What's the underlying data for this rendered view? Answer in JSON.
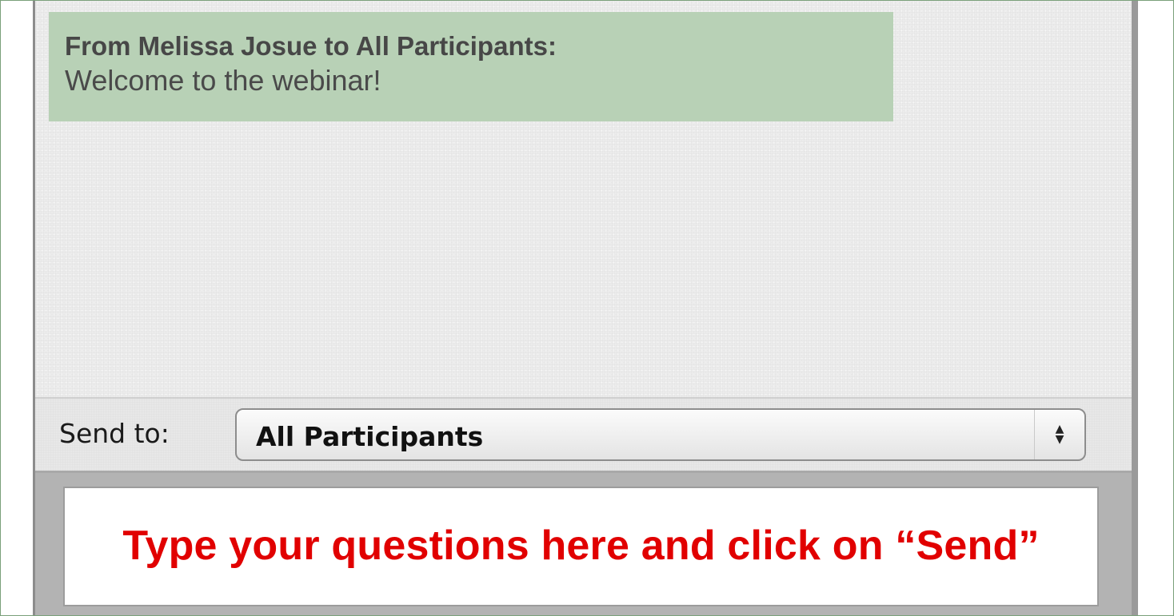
{
  "chat": {
    "message": {
      "header": "From Melissa Josue to All Participants:",
      "body": "Welcome to the webinar!"
    },
    "send_to": {
      "label": "Send to:",
      "selected": "All Participants"
    },
    "input": {
      "hint": "Type your questions here and click on “Send”"
    }
  },
  "icons": {
    "select_arrows": "up-down-chevron-icon"
  },
  "colors": {
    "callout_background": "#b8d1b6",
    "hint_text": "#e10000"
  }
}
